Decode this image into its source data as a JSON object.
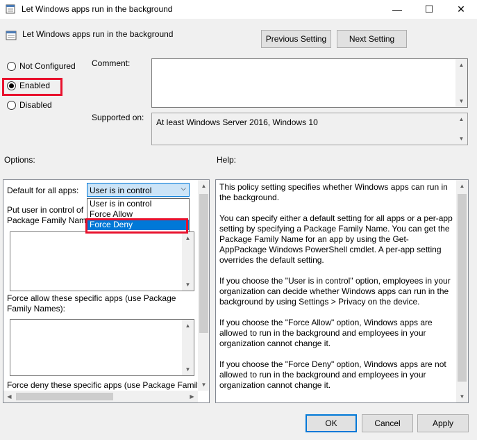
{
  "window": {
    "title": "Let Windows apps run in the background",
    "min_glyph": "—",
    "max_glyph": "☐",
    "close_glyph": "✕"
  },
  "header": {
    "policy_name": "Let Windows apps run in the background",
    "prev_label": "Previous Setting",
    "next_label": "Next Setting"
  },
  "state": {
    "options": [
      "Not Configured",
      "Enabled",
      "Disabled"
    ],
    "selected": "Enabled"
  },
  "comment": {
    "label": "Comment:",
    "value": ""
  },
  "supported": {
    "label": "Supported on:",
    "value": "At least Windows Server 2016, Windows 10"
  },
  "options_panel": {
    "title": "Options:",
    "default_label": "Default for all apps:",
    "default_value": "User is in control",
    "dropdown_items": [
      "User is in control",
      "Force Allow",
      "Force Deny"
    ],
    "dropdown_highlight": "Force Deny",
    "put_user_label": "Put user in control of",
    "put_user_label2": "Package Family Name",
    "force_allow_label": "Force allow these specific apps (use Package Family Names):",
    "force_deny_label": "Force deny these specific apps (use Package Family"
  },
  "help": {
    "title": "Help:",
    "paragraphs": [
      "This policy setting specifies whether Windows apps can run in the background.",
      "You can specify either a default setting for all apps or a per-app setting by specifying a Package Family Name. You can get the Package Family Name for an app by using the Get-AppPackage Windows PowerShell cmdlet. A per-app setting overrides the default setting.",
      "If you choose the \"User is in control\" option, employees in your organization can decide whether Windows apps can run in the background by using Settings > Privacy on the device.",
      "If you choose the \"Force Allow\" option, Windows apps are allowed to run in the background and employees in your organization cannot change it.",
      "If you choose the \"Force Deny\" option, Windows apps are not allowed to run in the background and employees in your organization cannot change it."
    ]
  },
  "footer": {
    "ok": "OK",
    "cancel": "Cancel",
    "apply": "Apply"
  },
  "colors": {
    "highlight_box": "#e8112d",
    "selection": "#0078d7"
  }
}
